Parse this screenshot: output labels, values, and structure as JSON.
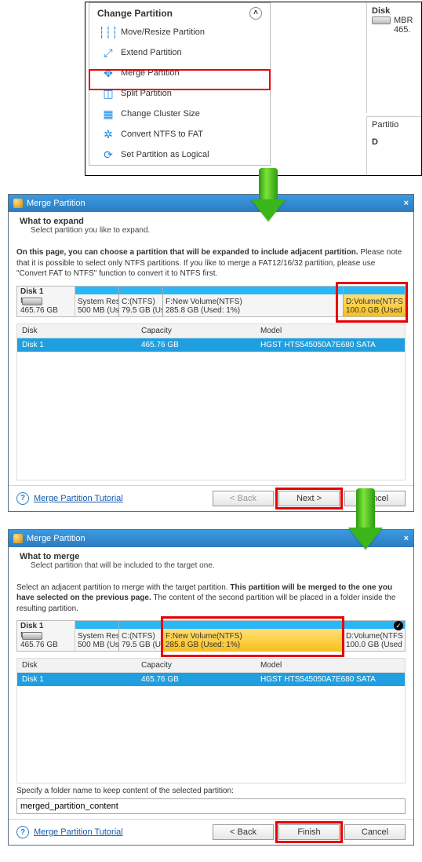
{
  "context_menu": {
    "title": "Change Partition",
    "items": [
      {
        "icon": "sliders-icon",
        "label": "Move/Resize Partition"
      },
      {
        "icon": "extend-icon",
        "label": "Extend Partition"
      },
      {
        "icon": "merge-icon",
        "label": "Merge Partition"
      },
      {
        "icon": "split-icon",
        "label": "Split Partition"
      },
      {
        "icon": "cluster-icon",
        "label": "Change Cluster Size"
      },
      {
        "icon": "convert-icon",
        "label": "Convert NTFS to FAT"
      },
      {
        "icon": "logical-icon",
        "label": "Set Partition as Logical"
      }
    ]
  },
  "side": {
    "disk_label": "Disk",
    "mbr": "MBR",
    "size": "465.",
    "part_label": "Partitio",
    "drive_letter": "D"
  },
  "dialog1": {
    "title": "Merge Partition",
    "sub_title": "What to expand",
    "sub_desc": "Select partition you like to expand.",
    "body_lead": "On this page, you can choose a partition that will be expanded to include adjacent partition.",
    "body_rest": " Please note that it is possible to select only NTFS partitions. If you like to merge a FAT12/16/32 partition, please use \"Convert FAT to NTFS\" function to convert it to NTFS first.",
    "disk": {
      "name": "Disk 1",
      "scheme": "MBR",
      "size": "465.76 GB"
    },
    "segments": [
      {
        "l1": "System Res",
        "l2": "500 MB (Us"
      },
      {
        "l1": "C:(NTFS)",
        "l2": "79.5 GB (Us"
      },
      {
        "l1": "F:New Volume(NTFS)",
        "l2": "285.8 GB (Used: 1%)"
      },
      {
        "l1": "D:Volume(NTFS",
        "l2": "100.0 GB (Used"
      }
    ],
    "table": {
      "headers": {
        "disk": "Disk",
        "cap": "Capacity",
        "model": "Model"
      },
      "row": {
        "disk": "Disk 1",
        "cap": "465.76 GB",
        "model": "HGST HTS545050A7E680 SATA"
      }
    },
    "help_link": "Merge Partition Tutorial",
    "buttons": {
      "back": "< Back",
      "next": "Next >",
      "cancel": "Cancel"
    }
  },
  "dialog2": {
    "title": "Merge Partition",
    "sub_title": "What to merge",
    "sub_desc": "Select partition that will be included to the target one.",
    "body_pre": "Select an adjacent partition to merge with the target partition. ",
    "body_bold": "This partition will be merged to the one you have selected on the previous page.",
    "body_post": " The content of the second partition will be placed in a folder inside the resulting partition.",
    "disk": {
      "name": "Disk 1",
      "scheme": "MBR",
      "size": "465.76 GB"
    },
    "segments": [
      {
        "l1": "System Res",
        "l2": "500 MB (Us"
      },
      {
        "l1": "C:(NTFS)",
        "l2": "79.5 GB (Us"
      },
      {
        "l1": "F:New Volume(NTFS)",
        "l2": "285.8 GB (Used: 1%)"
      },
      {
        "l1": "D:Volume(NTFS",
        "l2": "100.0 GB (Used"
      }
    ],
    "table": {
      "headers": {
        "disk": "Disk",
        "cap": "Capacity",
        "model": "Model"
      },
      "row": {
        "disk": "Disk 1",
        "cap": "465.76 GB",
        "model": "HGST HTS545050A7E680 SATA"
      }
    },
    "folder_label": "Specify a folder name to keep content of the selected partition:",
    "folder_value": "merged_partition_content",
    "help_link": "Merge Partition Tutorial",
    "buttons": {
      "back": "< Back",
      "finish": "Finish",
      "cancel": "Cancel"
    }
  }
}
